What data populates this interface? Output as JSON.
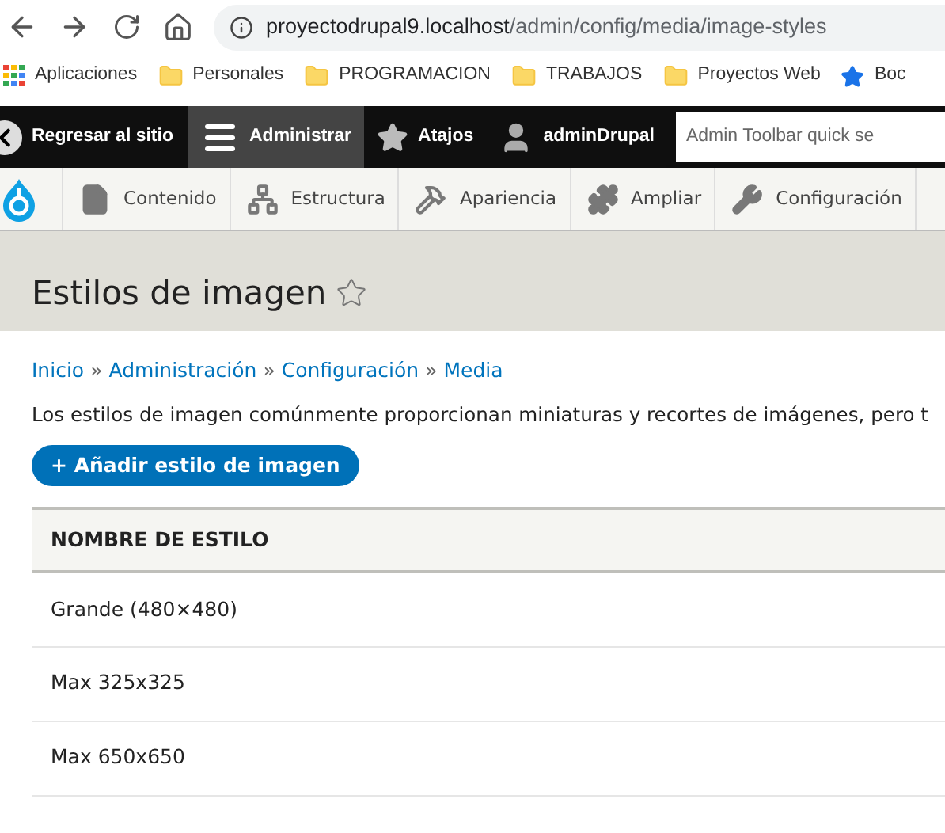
{
  "browser": {
    "url_host": "proyectodrupal9.localhost",
    "url_path": "/admin/config/media/image-styles",
    "bookmarks": [
      {
        "kind": "apps",
        "label": "Aplicaciones"
      },
      {
        "kind": "folder",
        "label": "Personales"
      },
      {
        "kind": "folder",
        "label": "PROGRAMACION"
      },
      {
        "kind": "folder",
        "label": "TRABAJOS"
      },
      {
        "kind": "folder",
        "label": "Proyectos Web"
      },
      {
        "kind": "star",
        "label": "Boc"
      }
    ]
  },
  "toolbar": {
    "items": [
      {
        "kind": "back",
        "label": "Regresar al sitio",
        "selected": false
      },
      {
        "kind": "menu",
        "label": "Administrar",
        "selected": true
      },
      {
        "kind": "star",
        "label": "Atajos",
        "selected": false
      },
      {
        "kind": "user",
        "label": "adminDrupal",
        "selected": false
      }
    ],
    "search": {
      "placeholder": "Admin Toolbar quick se"
    }
  },
  "tray": {
    "items": [
      {
        "kind": "file",
        "label": "Contenido"
      },
      {
        "kind": "structure",
        "label": "Estructura"
      },
      {
        "kind": "brush",
        "label": "Apariencia"
      },
      {
        "kind": "puzzle",
        "label": "Ampliar"
      },
      {
        "kind": "wrench",
        "label": "Configuración"
      }
    ]
  },
  "page": {
    "title": "Estilos de imagen",
    "breadcrumb": [
      {
        "kind": "link",
        "text": "Inicio"
      },
      {
        "kind": "sep",
        "text": "»"
      },
      {
        "kind": "link",
        "text": "Administración"
      },
      {
        "kind": "sep",
        "text": "»"
      },
      {
        "kind": "link",
        "text": "Configuración"
      },
      {
        "kind": "sep",
        "text": "»"
      },
      {
        "kind": "link",
        "text": "Media"
      }
    ],
    "description": "Los estilos de imagen comúnmente proporcionan miniaturas y recortes de imágenes, pero t",
    "add_button": "+ Añadir estilo de imagen",
    "table": {
      "columns": [
        "NOMBRE DE ESTILO"
      ],
      "rows": [
        [
          "Grande (480×480)"
        ],
        [
          "Max 325x325"
        ],
        [
          "Max 650x650"
        ]
      ]
    }
  }
}
